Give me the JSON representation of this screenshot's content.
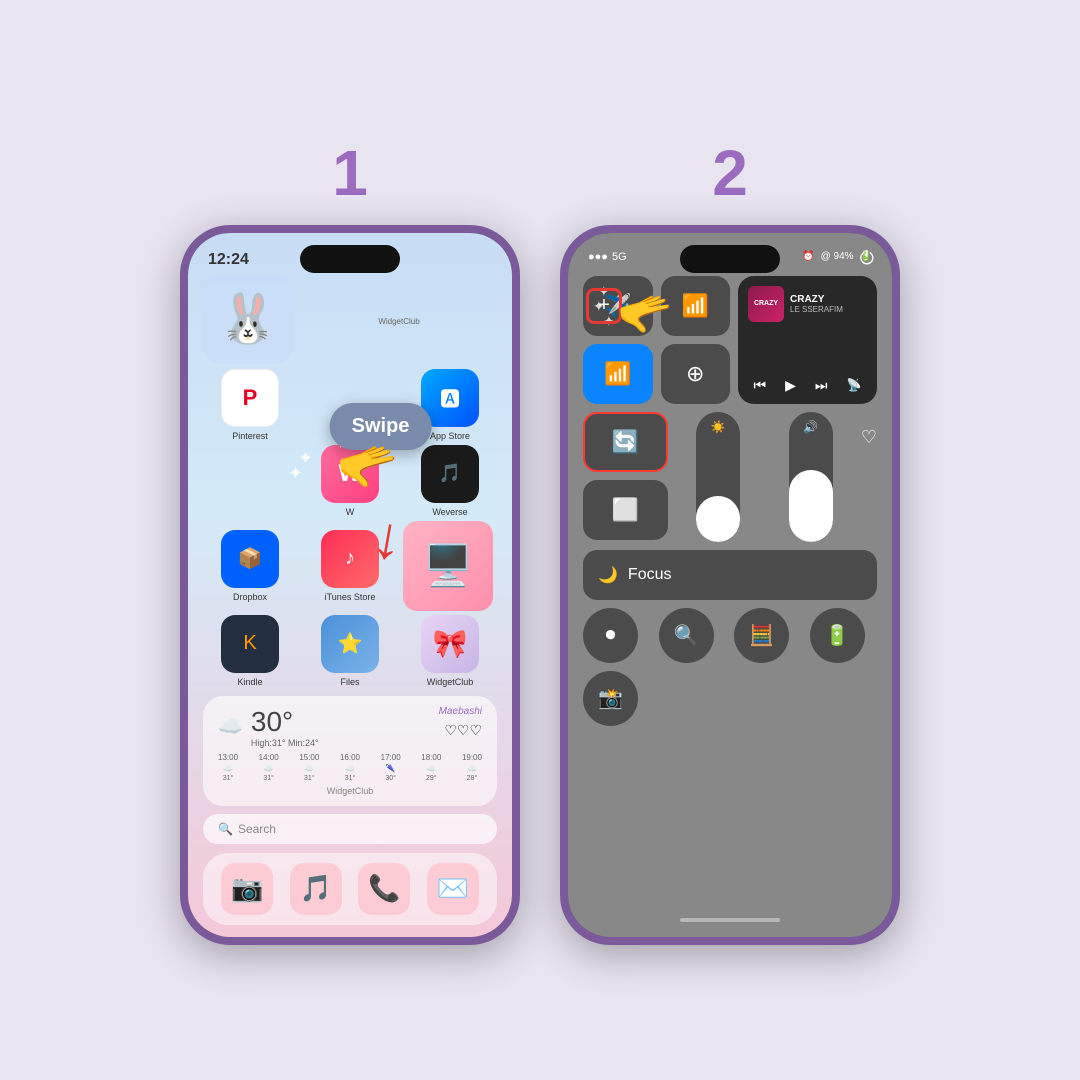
{
  "background_color": "#e8e4f0",
  "steps": [
    {
      "number": "1",
      "color": "#9b6bbf"
    },
    {
      "number": "2",
      "color": "#9b6bbf"
    }
  ],
  "phone1": {
    "time": "12:24",
    "swipe_label": "Swipe",
    "apps_row1": [
      {
        "name": "Pinterest",
        "icon": "P"
      },
      {
        "name": "App Store",
        "icon": "A"
      }
    ],
    "apps_row2": [
      {
        "name": "W",
        "icon": "W"
      },
      {
        "name": "Weverse",
        "icon": "🎵"
      }
    ],
    "apps_row3": [
      {
        "name": "Dropbox",
        "icon": "📦"
      },
      {
        "name": "iTunes Store",
        "icon": "♪"
      },
      {
        "name": "WidgetClub",
        "icon": "🖥️"
      }
    ],
    "apps_row4": [
      {
        "name": "Kindle",
        "icon": "K"
      },
      {
        "name": "Files",
        "icon": "⭐"
      },
      {
        "name": "WidgetClub",
        "icon": "🎀"
      }
    ],
    "widget_club_label": "WidgetClub",
    "weather": {
      "temp": "30°",
      "high": "High:31°",
      "min": "Min:24°",
      "location": "Maebashi",
      "hours": [
        "13:00",
        "14:00",
        "15:00",
        "16:00",
        "17:00",
        "18:00",
        "19:00"
      ],
      "temps": [
        "31°",
        "31°",
        "31°",
        "31°",
        "30°",
        "29°",
        "28°"
      ]
    },
    "search_placeholder": "🔍 Search",
    "dock_icons": [
      "📷",
      "🎵",
      "📞",
      "✉️"
    ]
  },
  "phone2": {
    "status": {
      "signal": "•••",
      "network": "5G",
      "battery": "94%",
      "alarm": "⏰"
    },
    "now_playing": {
      "title": "CRAZY",
      "artist": "LE SSERAFIM",
      "album_text": "CRAZY"
    },
    "focus_label": "Focus",
    "controls": [
      {
        "icon": "✈️",
        "label": "airplane"
      },
      {
        "icon": "📶",
        "label": "cellular"
      },
      {
        "icon": "🔵",
        "label": "wifi",
        "active": true
      },
      {
        "icon": "⋮",
        "label": "data"
      }
    ],
    "buttons": [
      {
        "icon": "🔍",
        "label": "magnifier"
      },
      {
        "icon": "🧮",
        "label": "calculator"
      },
      {
        "icon": "🔋",
        "label": "battery"
      },
      {
        "icon": "📸",
        "label": "camera"
      }
    ],
    "plus_button_label": "+"
  }
}
